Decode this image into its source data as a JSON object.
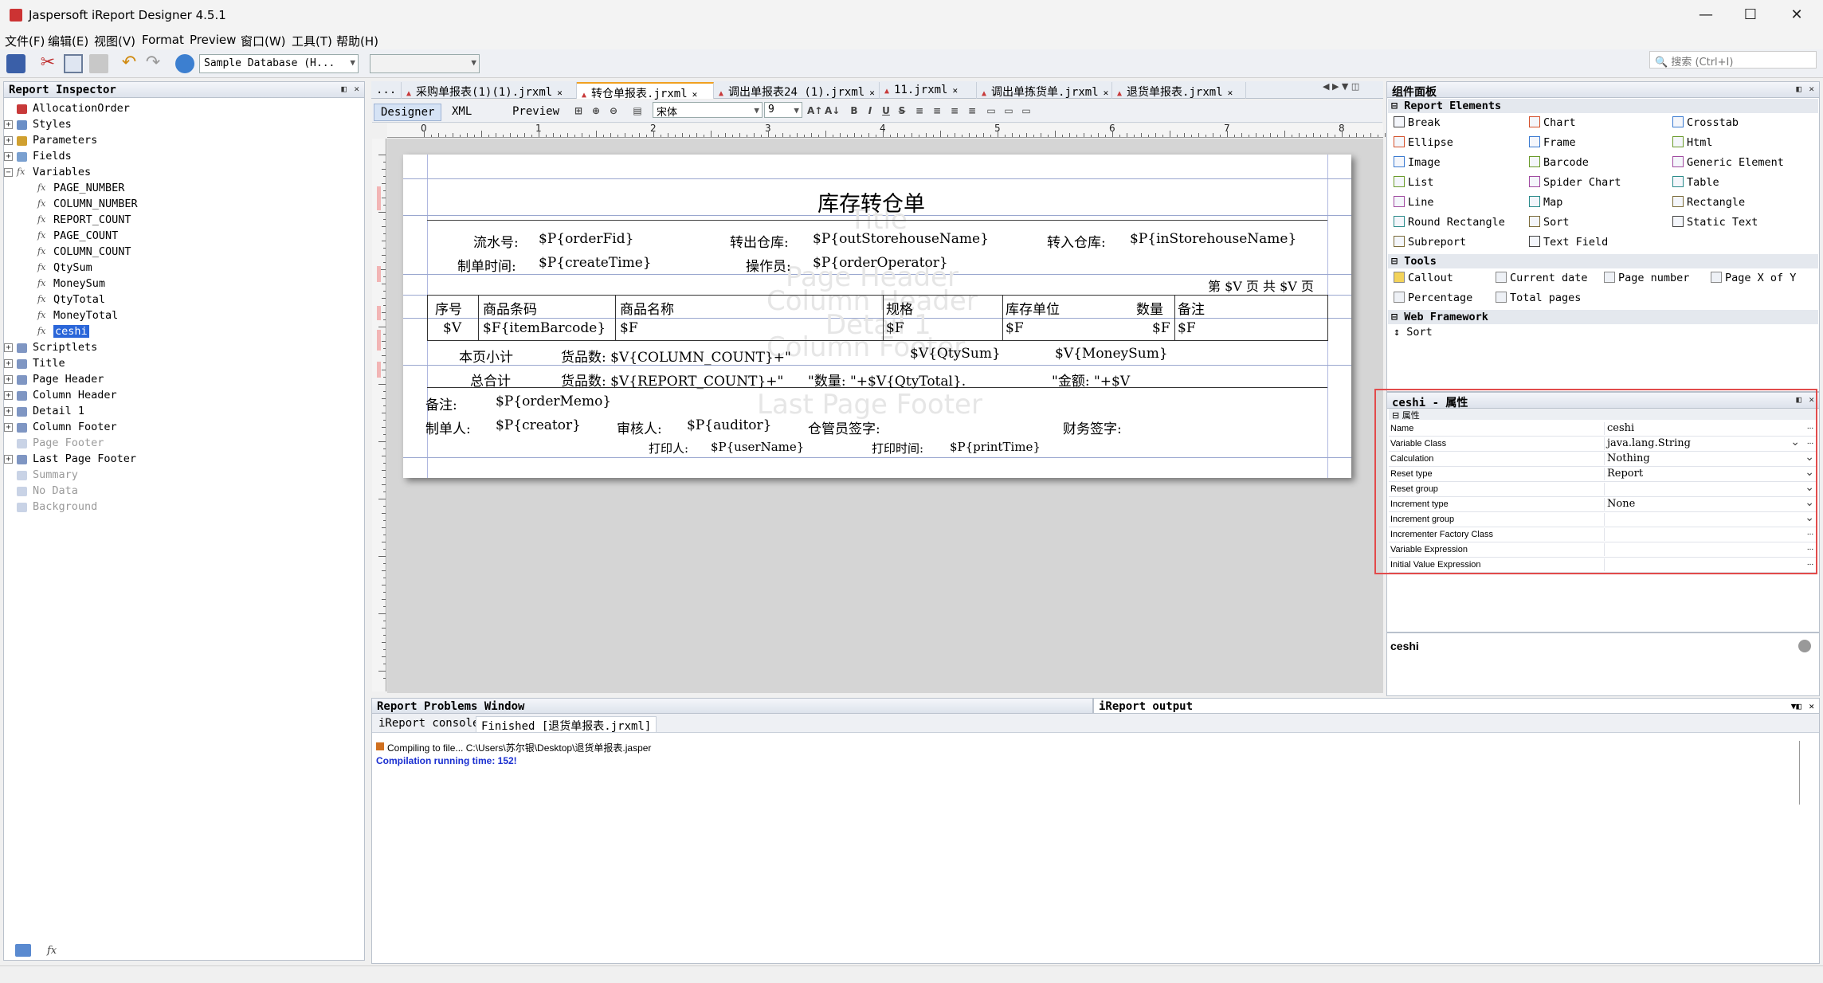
{
  "window": {
    "title": "Jaspersoft iReport Designer 4.5.1"
  },
  "menu": [
    "文件(F)",
    "编辑(E)",
    "视图(V)",
    "Format",
    "Preview",
    "窗口(W)",
    "工具(T)",
    "帮助(H)"
  ],
  "toolbar": {
    "datasource": "Sample Database (H...",
    "search_placeholder": "搜索 (Ctrl+I)"
  },
  "inspector": {
    "title": "Report Inspector",
    "root": "AllocationOrder",
    "top_items": [
      "Styles",
      "Parameters",
      "Fields",
      "Variables"
    ],
    "variables": [
      "PAGE_NUMBER",
      "COLUMN_NUMBER",
      "REPORT_COUNT",
      "PAGE_COUNT",
      "COLUMN_COUNT",
      "QtySum",
      "MoneySum",
      "QtyTotal",
      "MoneyTotal",
      "ceshi"
    ],
    "bands": [
      {
        "label": "Scriptlets",
        "dim": false
      },
      {
        "label": "Title",
        "dim": false
      },
      {
        "label": "Page Header",
        "dim": false
      },
      {
        "label": "Column Header",
        "dim": false
      },
      {
        "label": "Detail 1",
        "dim": false
      },
      {
        "label": "Column Footer",
        "dim": false
      },
      {
        "label": "Page Footer",
        "dim": true
      },
      {
        "label": "Last Page Footer",
        "dim": false
      },
      {
        "label": "Summary",
        "dim": true
      },
      {
        "label": "No Data",
        "dim": true
      },
      {
        "label": "Background",
        "dim": true
      }
    ]
  },
  "tabs": [
    {
      "label": "...",
      "active": false
    },
    {
      "label": "采购单报表(1)(1).jrxml",
      "active": false
    },
    {
      "label": "转仓单报表.jrxml",
      "active": true
    },
    {
      "label": "调出单报表24 (1).jrxml",
      "active": false
    },
    {
      "label": "11.jrxml",
      "active": false
    },
    {
      "label": "调出单拣货单.jrxml",
      "active": false
    },
    {
      "label": "退货单报表.jrxml",
      "active": false
    }
  ],
  "designer_tabs": [
    "Designer",
    "XML",
    "Preview"
  ],
  "format": {
    "font": "宋体",
    "size": "9"
  },
  "ruler": {
    "h": [
      "0",
      "1",
      "2",
      "3",
      "4",
      "5",
      "6",
      "7",
      "8"
    ]
  },
  "report": {
    "title": "库存转仓单",
    "band_labels": [
      "Title",
      "Page Header",
      "Column Header",
      "Detail 1",
      "Column Footer",
      "Last Page Footer"
    ],
    "row1": {
      "l1": "流水号:",
      "v1": "$P{orderFid}",
      "l2": "转出仓库:",
      "v2": "$P{outStorehouseName}",
      "l3": "转入仓库:",
      "v3": "$P{inStorehouseName}"
    },
    "row2": {
      "l1": "制单时间:",
      "v1": "$P{createTime}",
      "l2": "操作员:",
      "v2": "$P{orderOperator}"
    },
    "pageinfo": "第 $V 页  共 $V 页",
    "headers": [
      "序号",
      "商品条码",
      "商品名称",
      "规格",
      "库存单位",
      "数量",
      "备注"
    ],
    "detail": [
      "$V",
      "$F{itemBarcode}",
      "$F",
      "$F",
      "$F",
      "$F",
      "$F"
    ],
    "colfooter": {
      "l": "本页小计",
      "a": "货品数: $V{COLUMN_COUNT}+\"",
      "b": "$V{QtySum}",
      "c": "$V{MoneySum}"
    },
    "total": {
      "l": "总合计",
      "a": "货品数: $V{REPORT_COUNT}+\"",
      "b": "\"数量: \"+$V{QtyTotal}.",
      "c": "\"金额:    \"+$V"
    },
    "memo": {
      "l": "备注:",
      "v": "$P{orderMemo}"
    },
    "sign": {
      "l1": "制单人:",
      "v1": "$P{creator}",
      "l2": "审核人:",
      "v2": "$P{auditor}",
      "l3": "仓管员签字:",
      "l4": "财务签字:"
    },
    "print": {
      "l1": "打印人:",
      "v1": "$P{userName}",
      "l2": "打印时间:",
      "v2": "$P{printTime}"
    }
  },
  "palette": {
    "title": "组件面板",
    "sections": {
      "elements": "Report Elements",
      "tools": "Tools",
      "web": "Web Framework"
    },
    "elements": [
      [
        "Break",
        "Chart",
        "Crosstab"
      ],
      [
        "Ellipse",
        "Frame",
        "Html"
      ],
      [
        "Image",
        "Barcode",
        "Generic Element"
      ],
      [
        "List",
        "Spider Chart",
        "Table"
      ],
      [
        "Line",
        "Map",
        "Rectangle"
      ],
      [
        "Round Rectangle",
        "Sort",
        "Static Text"
      ],
      [
        "Subreport",
        "Text Field",
        ""
      ]
    ],
    "tools": [
      [
        "Callout",
        "Current date",
        "Page number",
        "Page X of Y"
      ],
      [
        "Percentage",
        "Total pages",
        "",
        ""
      ]
    ],
    "web": [
      "Sort"
    ]
  },
  "properties": {
    "title": "ceshi - 属性",
    "section": "属性",
    "rows": [
      {
        "name": "Name",
        "value": "ceshi",
        "dropdown": false,
        "btn": true
      },
      {
        "name": "Variable Class",
        "value": "java.lang.String",
        "dropdown": true,
        "btn": true
      },
      {
        "name": "Calculation",
        "value": "Nothing",
        "dropdown": true,
        "btn": false
      },
      {
        "name": "Reset type",
        "value": "Report",
        "dropdown": true,
        "btn": false
      },
      {
        "name": "Reset group",
        "value": "",
        "dropdown": true,
        "btn": false
      },
      {
        "name": "Increment type",
        "value": "None",
        "dropdown": true,
        "btn": false
      },
      {
        "name": "Increment group",
        "value": "",
        "dropdown": true,
        "btn": false
      },
      {
        "name": "Incrementer Factory Class",
        "value": "",
        "dropdown": false,
        "btn": true
      },
      {
        "name": "Variable Expression",
        "value": "",
        "dropdown": false,
        "btn": true
      },
      {
        "name": "Initial Value Expression",
        "value": "",
        "dropdown": false,
        "btn": true
      }
    ],
    "desc_title": "ceshi"
  },
  "bottom": {
    "problems_title": "Report Problems Window",
    "output_title": "iReport output",
    "console_tabs": [
      "iReport console",
      "Finished [退货单报表.jrxml]"
    ],
    "lines": [
      {
        "text": "Compiling to file... C:\\Users\\苏尔银\\Desktop\\退货单报表.jasper",
        "color": "#000000",
        "bold": false
      },
      {
        "text": "Compilation running time: 152!",
        "color": "#1a2fd0",
        "bold": true
      }
    ]
  }
}
